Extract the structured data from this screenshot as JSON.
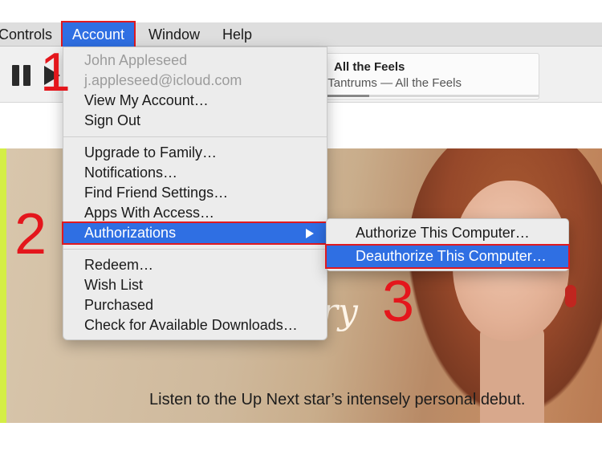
{
  "menubar": {
    "items": [
      "Controls",
      "Account",
      "Window",
      "Help"
    ],
    "active_index": 1
  },
  "now_playing": {
    "title": "All the Feels",
    "subtitle": "e Tantrums — All the Feels",
    "progress": 0.23
  },
  "account_menu": {
    "user_name": "John Appleseed",
    "user_email": "j.appleseed@icloud.com",
    "group1": [
      "View My Account…",
      "Sign Out"
    ],
    "group2": [
      "Upgrade to Family…",
      "Notifications…",
      "Find Friend Settings…",
      "Apps With Access…",
      "Authorizations"
    ],
    "group3": [
      "Redeem…",
      "Wish List",
      "Purchased",
      "Check for Available Downloads…"
    ],
    "highlighted_item": "Authorizations"
  },
  "authorizations_submenu": {
    "items": [
      "Authorize This Computer…",
      "Deauthorize This Computer…"
    ],
    "highlighted_index": 1
  },
  "banner": {
    "script_fragment": "ry",
    "caption": "Listen to the Up Next star’s intensely personal debut."
  },
  "annotations": {
    "step1": "1",
    "step2": "2",
    "step3": "3",
    "color": "#e4161c"
  },
  "colors": {
    "highlight": "#2f6fe3",
    "outline": "#e0191f",
    "menu_bg": "#ececec"
  }
}
